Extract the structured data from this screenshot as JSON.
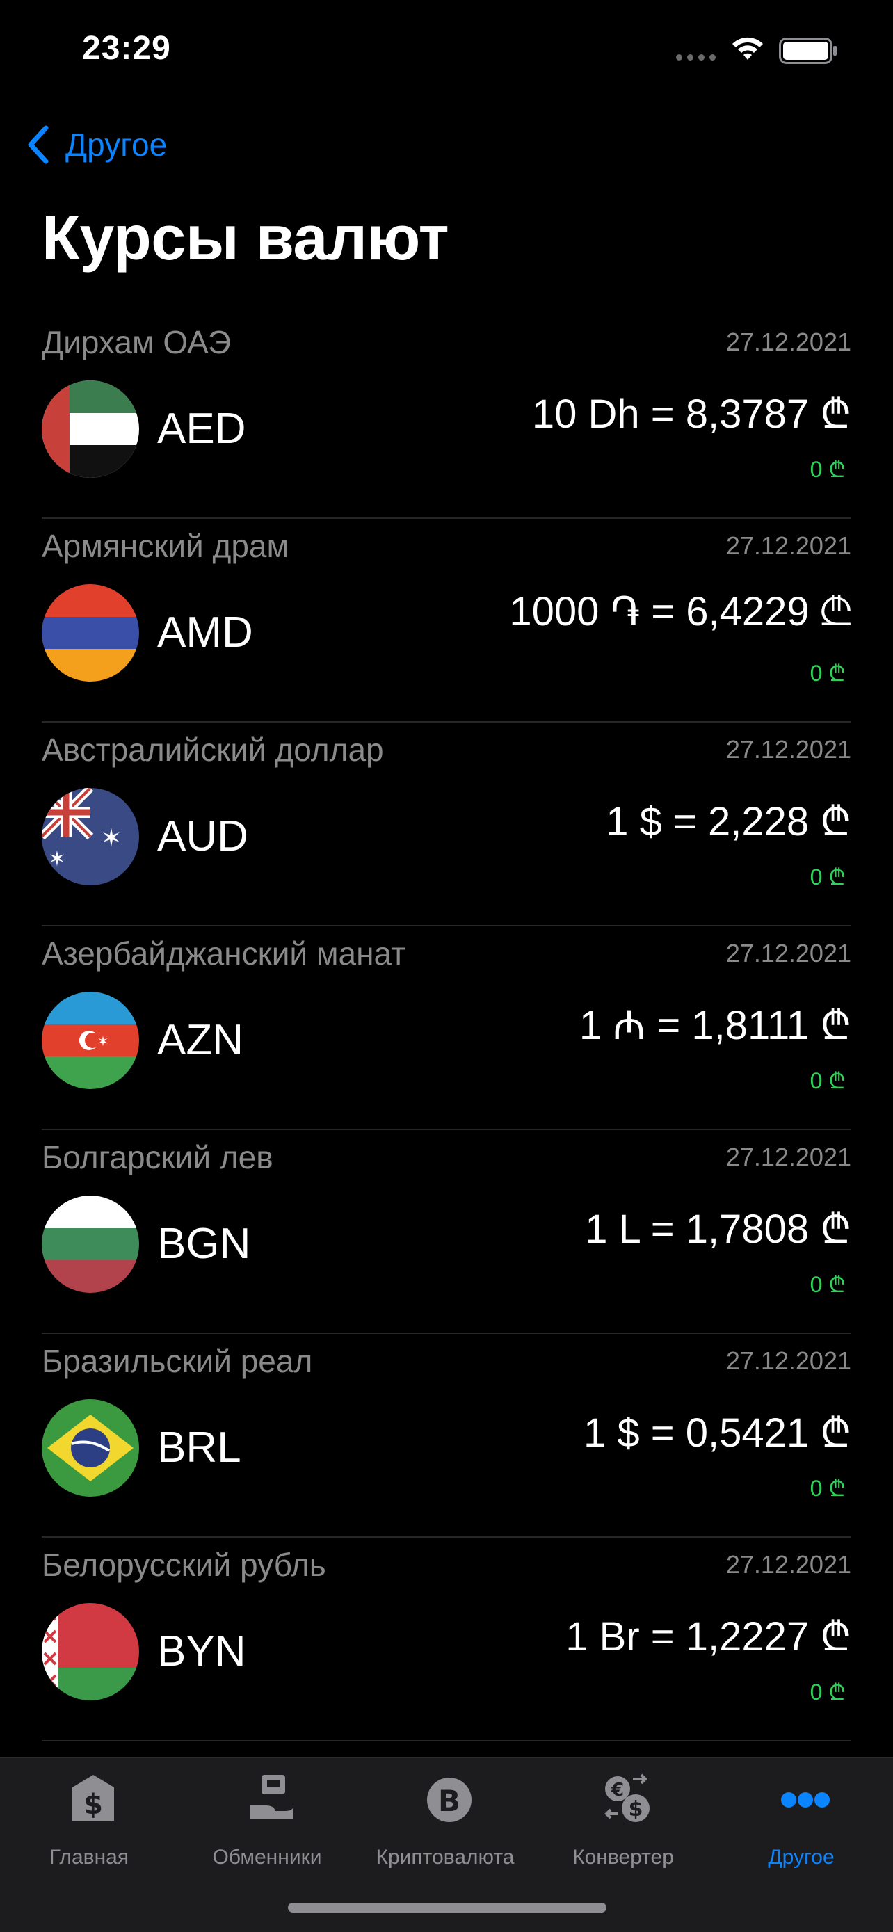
{
  "status_bar": {
    "time": "23:29"
  },
  "nav": {
    "back_label": "Другое",
    "title": "Курсы валют"
  },
  "rates": [
    {
      "name": "Дирхам ОАЭ",
      "date": "27.12.2021",
      "code": "AED",
      "rate": "10 Dh = 8,3787 ₾",
      "change": "0 ₾"
    },
    {
      "name": "Армянский драм",
      "date": "27.12.2021",
      "code": "AMD",
      "rate": "1000 ֏ = 6,4229 ₾",
      "change": "0 ₾"
    },
    {
      "name": "Австралийский доллар",
      "date": "27.12.2021",
      "code": "AUD",
      "rate": "1 $ = 2,228 ₾",
      "change": "0 ₾"
    },
    {
      "name": "Азербайджанский манат",
      "date": "27.12.2021",
      "code": "AZN",
      "rate": "1 ₼ = 1,8111 ₾",
      "change": "0 ₾"
    },
    {
      "name": "Болгарский лев",
      "date": "27.12.2021",
      "code": "BGN",
      "rate": "1 L = 1,7808 ₾",
      "change": "0 ₾"
    },
    {
      "name": "Бразильский реал",
      "date": "27.12.2021",
      "code": "BRL",
      "rate": "1 $ = 0,5421 ₾",
      "change": "0 ₾"
    },
    {
      "name": "Белорусский рубль",
      "date": "27.12.2021",
      "code": "BYN",
      "rate": "1 Br = 1,2227 ₾",
      "change": "0 ₾"
    }
  ],
  "tabs": [
    {
      "label": "Главная",
      "icon": "bank-dollar-icon"
    },
    {
      "label": "Обменники",
      "icon": "exchange-office-icon"
    },
    {
      "label": "Криптовалюта",
      "icon": "bitcoin-icon"
    },
    {
      "label": "Конвертер",
      "icon": "currency-convert-icon"
    },
    {
      "label": "Другое",
      "icon": "more-dots-icon",
      "active": true
    }
  ],
  "colors": {
    "accent": "#0a84ff",
    "positive": "#30d158",
    "secondary_text": "#8a8a8a",
    "background": "#000000"
  }
}
